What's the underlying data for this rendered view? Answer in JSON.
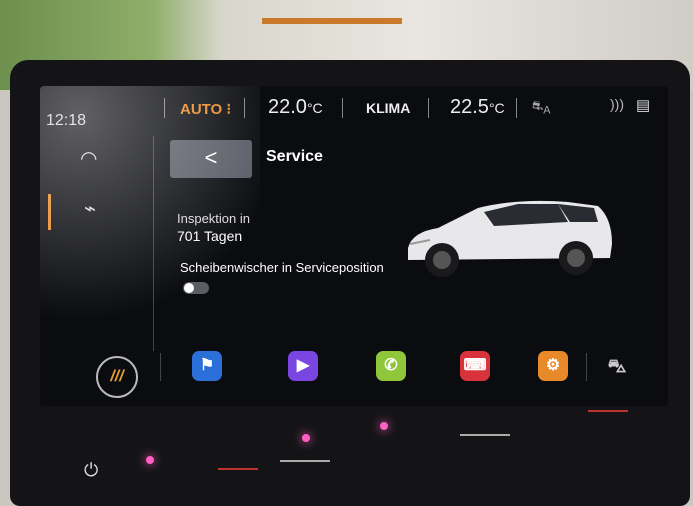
{
  "status_bar": {
    "time": "12:18",
    "mode": "AUTO",
    "temp_left": "22.0",
    "temp_left_unit": "°C",
    "climate": "KLIMA",
    "temp_right": "22.5",
    "temp_right_unit": "°C",
    "recirc_label": "A"
  },
  "header": {
    "back_label": "<",
    "title": "Service"
  },
  "service": {
    "inspection_label": "Inspektion in",
    "inspection_value": "701 Tagen",
    "wiper_label": "Scheibenwischer in Serviceposition",
    "wiper_toggle_on": false
  },
  "sidebar": {
    "menu_label": "///"
  },
  "colors": {
    "accent": "#e88a2a",
    "nav_app": "#2b6fd9",
    "media_app": "#7a45e0",
    "phone_app": "#8fc63a",
    "keyboard_app": "#d8323c",
    "service_app": "#e98a2a"
  },
  "icons": {
    "sidebar": [
      "speedometer-icon",
      "heartbeat-icon"
    ],
    "status": [
      "car-recirc-icon",
      "wireless-icon",
      "document-icon"
    ],
    "dock": [
      "nav-flag-icon",
      "play-icon",
      "phone-icon",
      "keyboard-icon",
      "car-service-icon",
      "car-outline-icon"
    ]
  }
}
